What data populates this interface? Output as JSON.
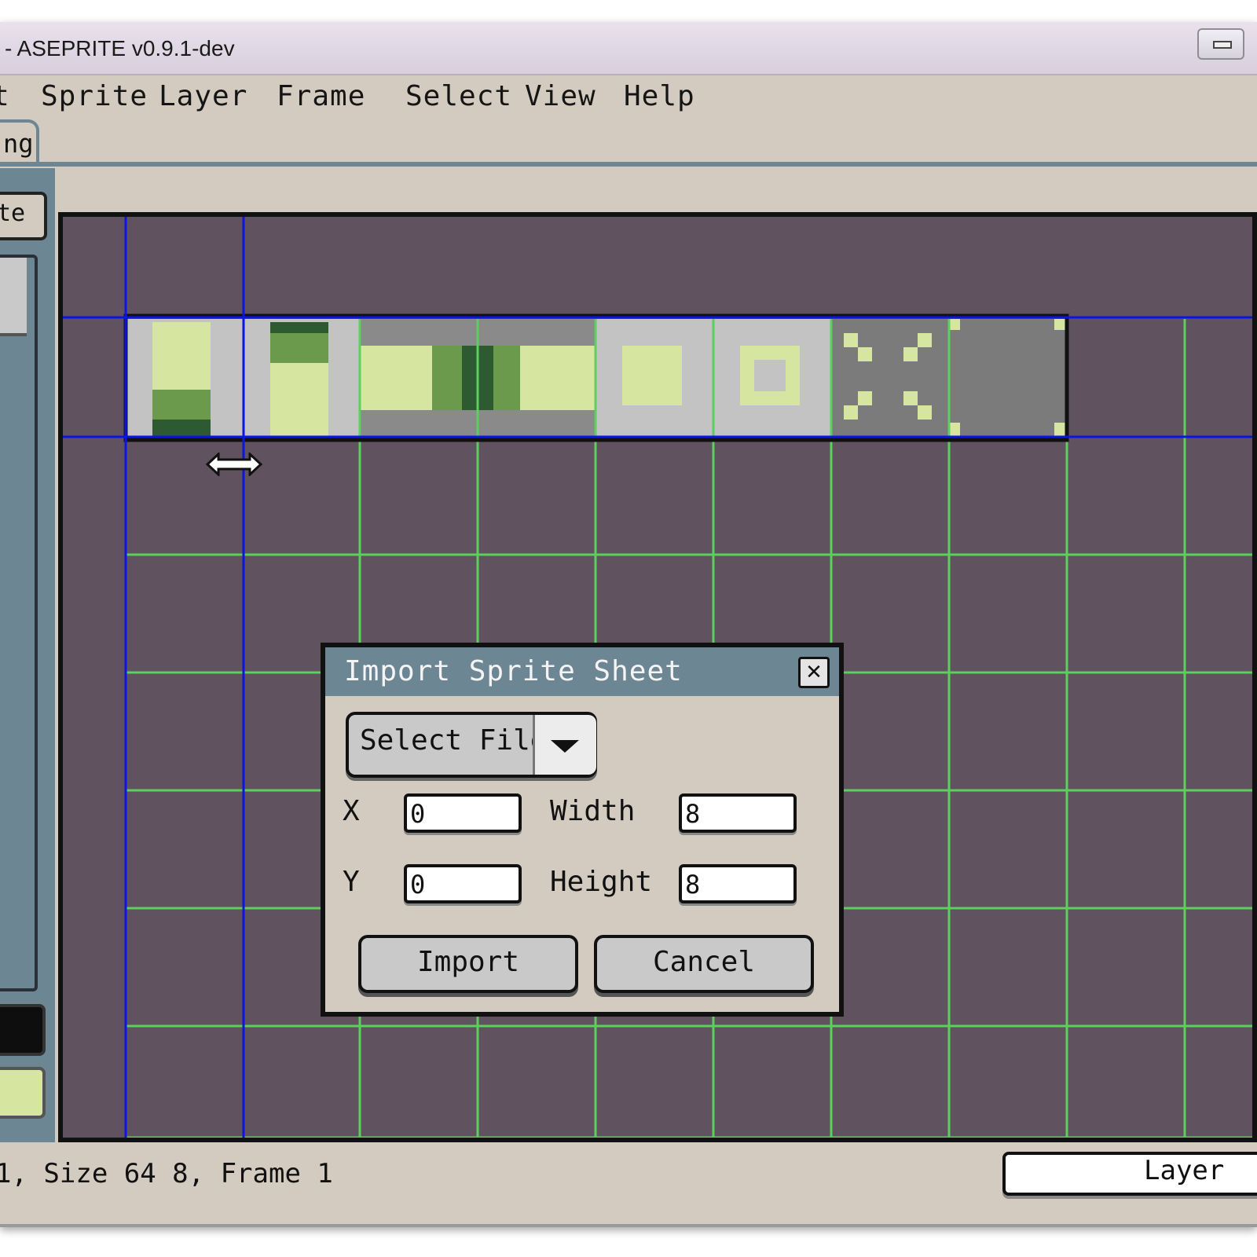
{
  "window": {
    "title": "- ASEPRITE v0.9.1-dev"
  },
  "menu": [
    "t",
    "Sprite",
    "Layer",
    "Frame",
    "Select",
    "View",
    "Help"
  ],
  "tab": {
    "label": "ng"
  },
  "sidebar": {
    "palette_label": "te"
  },
  "status": {
    "text": "1, Size 64 8, Frame 1",
    "layer_label": "Layer"
  },
  "dialog": {
    "title": "Import Sprite Sheet",
    "close_icon": "close-icon",
    "select_file_label": "Select File",
    "x_label": "X",
    "y_label": "Y",
    "width_label": "Width",
    "height_label": "Height",
    "x_value": "0",
    "y_value": "0",
    "width_value": "8",
    "height_value": "8",
    "import_label": "Import",
    "cancel_label": "Cancel"
  },
  "colors": {
    "canvas_bg": "#615260",
    "grid_green": "#5ccf5c",
    "selection_blue": "#0a14e6",
    "panel": "#6d8693",
    "chrome": "#d4cbc0"
  }
}
